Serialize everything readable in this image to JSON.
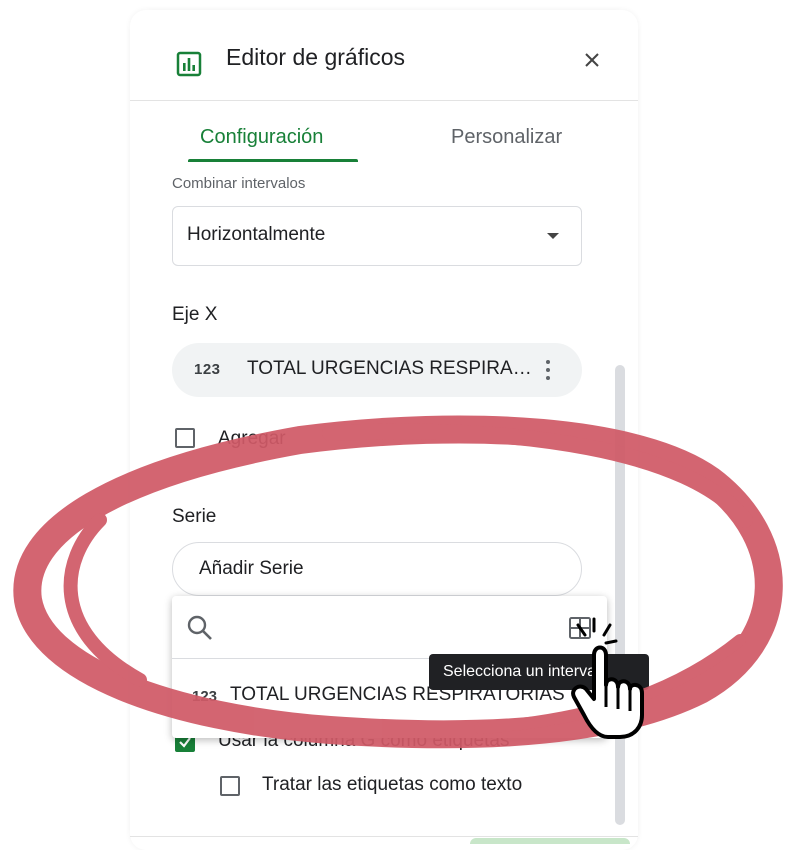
{
  "header": {
    "title": "Editor de gráficos",
    "icon": "bar-chart-icon",
    "close_icon": "close-icon"
  },
  "tabs": [
    {
      "label": "Configuración",
      "active": true
    },
    {
      "label": "Personalizar",
      "active": false
    }
  ],
  "combine_ranges": {
    "label": "Combinar intervalos",
    "selected": "Horizontalmente"
  },
  "x_axis": {
    "label": "Eje X",
    "chip": {
      "type_glyph": "123",
      "text": "TOTAL URGENCIAS RESPIRA…"
    },
    "add_checkbox": {
      "label": "Agregar",
      "checked": false
    }
  },
  "series": {
    "label": "Serie",
    "add_placeholder": "Añadir Serie",
    "popup": {
      "search_icon": "search-icon",
      "range_icon": "select-range-icon",
      "item": {
        "type_glyph": "123",
        "text": "TOTAL URGENCIAS RESPIRATORIAS"
      }
    }
  },
  "tooltip": {
    "text": "Selecciona un intervalo"
  },
  "options": {
    "use_column_as_labels": {
      "label": "Usar la columna G como etiquetas",
      "checked": true
    },
    "treat_labels_as_text": {
      "label": "Tratar las etiquetas como texto",
      "checked": false
    }
  },
  "colors": {
    "accent": "#188038",
    "annotation": "#d05a67"
  }
}
